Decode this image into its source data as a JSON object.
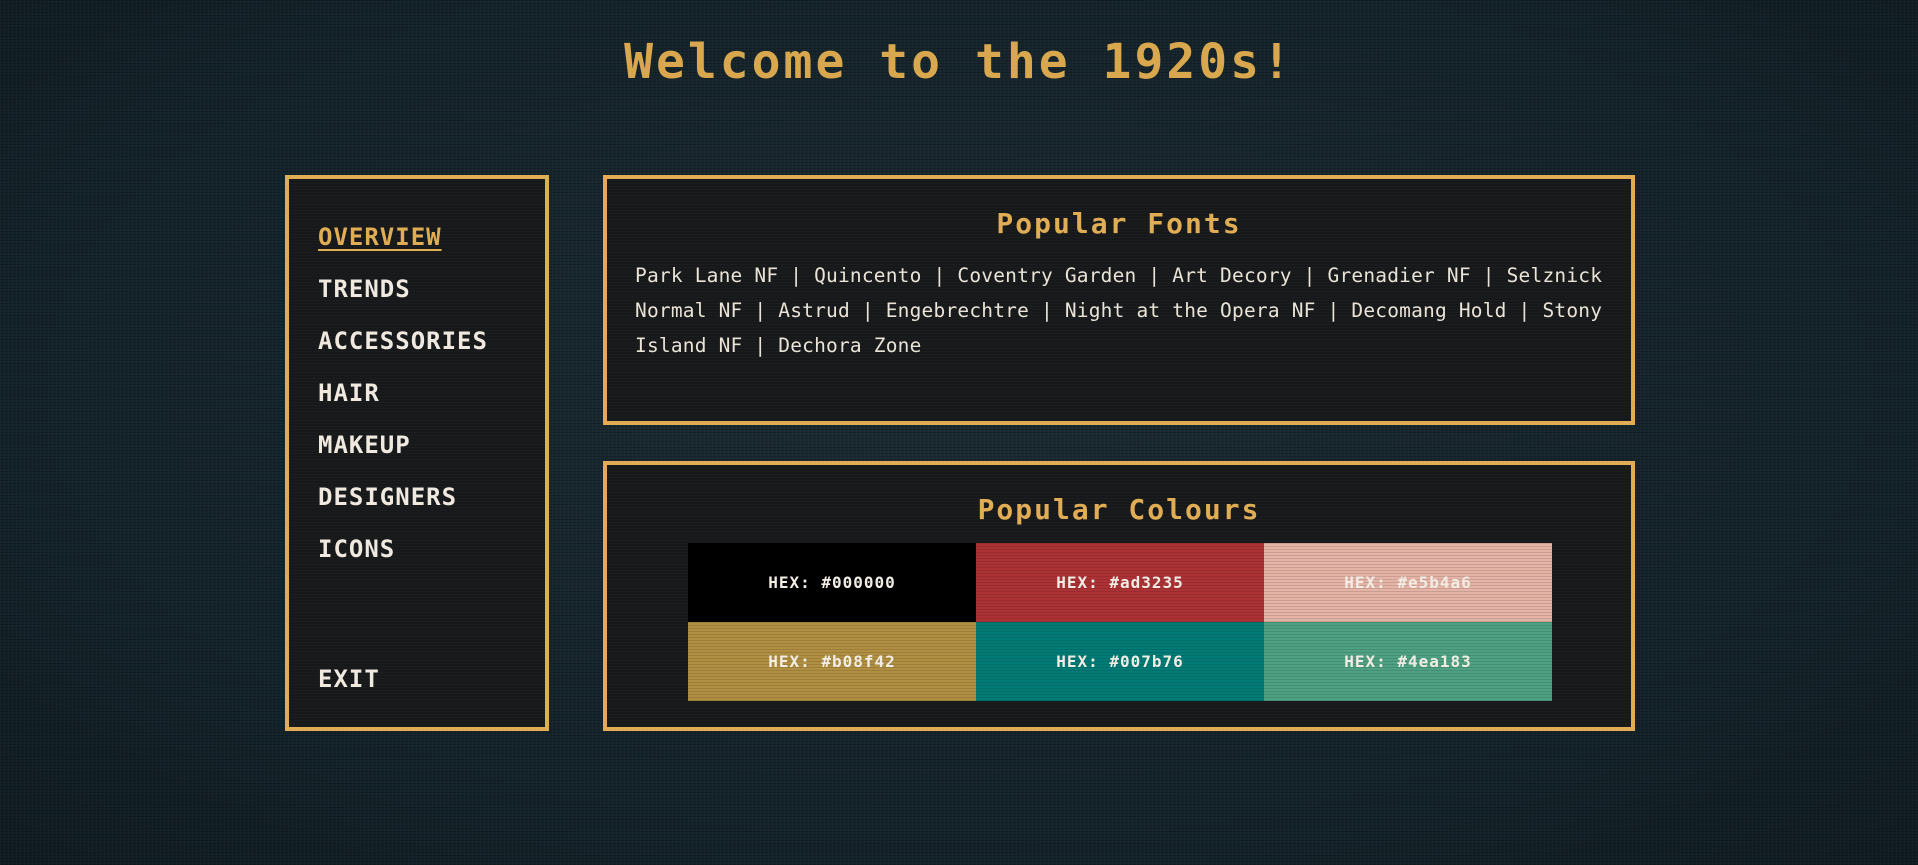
{
  "page": {
    "title": "Welcome to the 1920s!"
  },
  "sidebar": {
    "items": [
      {
        "label": "OVERVIEW",
        "active": true
      },
      {
        "label": "TRENDS",
        "active": false
      },
      {
        "label": "ACCESSORIES",
        "active": false
      },
      {
        "label": "HAIR",
        "active": false
      },
      {
        "label": "MAKEUP",
        "active": false
      },
      {
        "label": "DESIGNERS",
        "active": false
      },
      {
        "label": "ICONS",
        "active": false
      }
    ],
    "exit_label": "EXIT"
  },
  "fonts": {
    "title": "Popular Fonts",
    "list_text": "Park Lane NF | Quincento | Coventry Garden | Art Decory | Grenadier NF | Selznick Normal NF | Astrud | Engebrechtre | Night at the Opera NF | Decomang Hold | Stony Island NF | Dechora Zone"
  },
  "colours": {
    "title": "Popular Colours",
    "swatches": [
      {
        "label": "HEX: #000000",
        "color": "#000000"
      },
      {
        "label": "HEX: #ad3235",
        "color": "#ad3235"
      },
      {
        "label": "HEX: #e5b4a6",
        "color": "#e5b4a6"
      },
      {
        "label": "HEX: #b08f42",
        "color": "#b08f42"
      },
      {
        "label": "HEX: #007b76",
        "color": "#007b76"
      },
      {
        "label": "HEX: #4ea183",
        "color": "#4ea183"
      }
    ]
  },
  "theme": {
    "accent": "#e0ad55",
    "text": "#efe9e0",
    "background": "#17262b"
  }
}
